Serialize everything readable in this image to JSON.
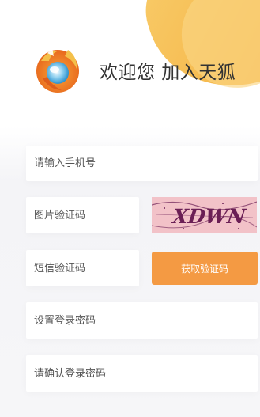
{
  "header": {
    "welcome_text": "欢迎您 加入天狐"
  },
  "form": {
    "phone_placeholder": "请输入手机号",
    "image_code_placeholder": "图片验证码",
    "sms_code_placeholder": "短信验证码",
    "sms_button_label": "获取验证码",
    "password_placeholder": "设置登录密码",
    "confirm_password_placeholder": "请确认登录密码"
  },
  "captcha": {
    "text": "XDWN"
  },
  "colors": {
    "accent": "#f49a43",
    "captcha_bg": "#f2c2c8",
    "captcha_ink": "#6b1f55"
  },
  "icons": {
    "logo": "tianhu-fox-logo-icon"
  }
}
